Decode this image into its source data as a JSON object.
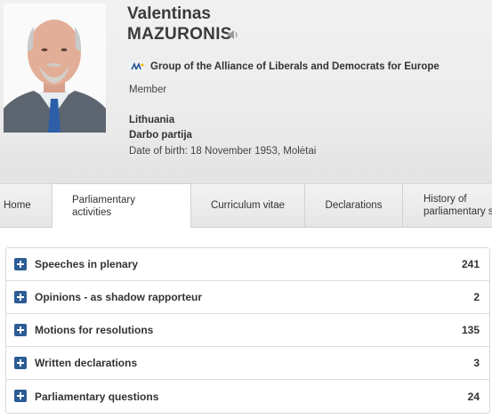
{
  "mep": {
    "first_name": "Valentinas",
    "last_name": "MAZURONIS",
    "group": "Group of the Alliance of Liberals and Democrats for Europe",
    "role": "Member",
    "country": "Lithuania",
    "party": "Darbo partija",
    "date_of_birth": "Date of birth: 18 November 1953, Molėtai"
  },
  "icons": {
    "speaker": "speaker-icon",
    "group": "alde-group-icon",
    "expand": "plus-icon"
  },
  "tabs": [
    {
      "label": "Home"
    },
    {
      "label": "Parliamentary activities",
      "line1": "Parliamentary",
      "line2": "activities",
      "active": true
    },
    {
      "label": "Curriculum vitae"
    },
    {
      "label": "Declarations"
    },
    {
      "label": "History of parliamentary service",
      "line1": "History of",
      "line2": "parliamentary s"
    }
  ],
  "activities": [
    {
      "label": "Speeches in plenary",
      "count": "241"
    },
    {
      "label": "Opinions - as shadow rapporteur",
      "count": "2"
    },
    {
      "label": "Motions for resolutions",
      "count": "135"
    },
    {
      "label": "Written declarations",
      "count": "3"
    },
    {
      "label": "Parliamentary questions",
      "count": "24"
    }
  ],
  "colors": {
    "expand_button": "#2c5d94",
    "group_icon": "#1c4e8a"
  }
}
